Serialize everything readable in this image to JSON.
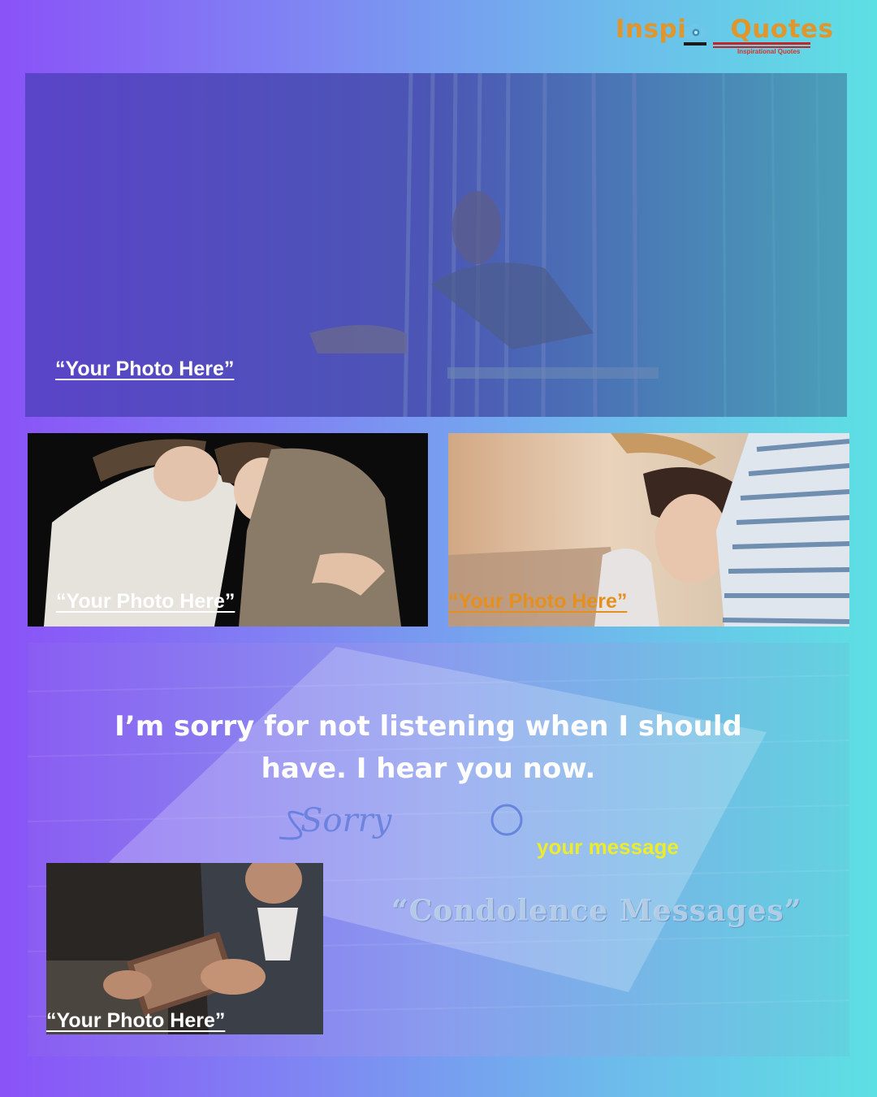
{
  "logo": {
    "part1": "Inspi",
    "part2": "Quotes",
    "subtitle": "Inspirational Quotes"
  },
  "photos": {
    "top_caption": "“Your Photo Here”",
    "left_caption": "“Your Photo Here”",
    "right_caption": "“Your Photo Here”",
    "inset_caption": "“Your Photo Here”"
  },
  "quote": "I’m sorry for not listening when I should have. I hear you now.",
  "handwritten_note": "Sorry",
  "message_label": "your message",
  "category": "“Condolence Messages”",
  "colors": {
    "bg_left": "#8a52f7",
    "bg_right": "#5de0e3",
    "caption": "#ffffff",
    "caption_orange": "#e5901e",
    "message": "#ecec2c",
    "logo_orange": "#e0962c",
    "logo_red": "#d8322e"
  }
}
